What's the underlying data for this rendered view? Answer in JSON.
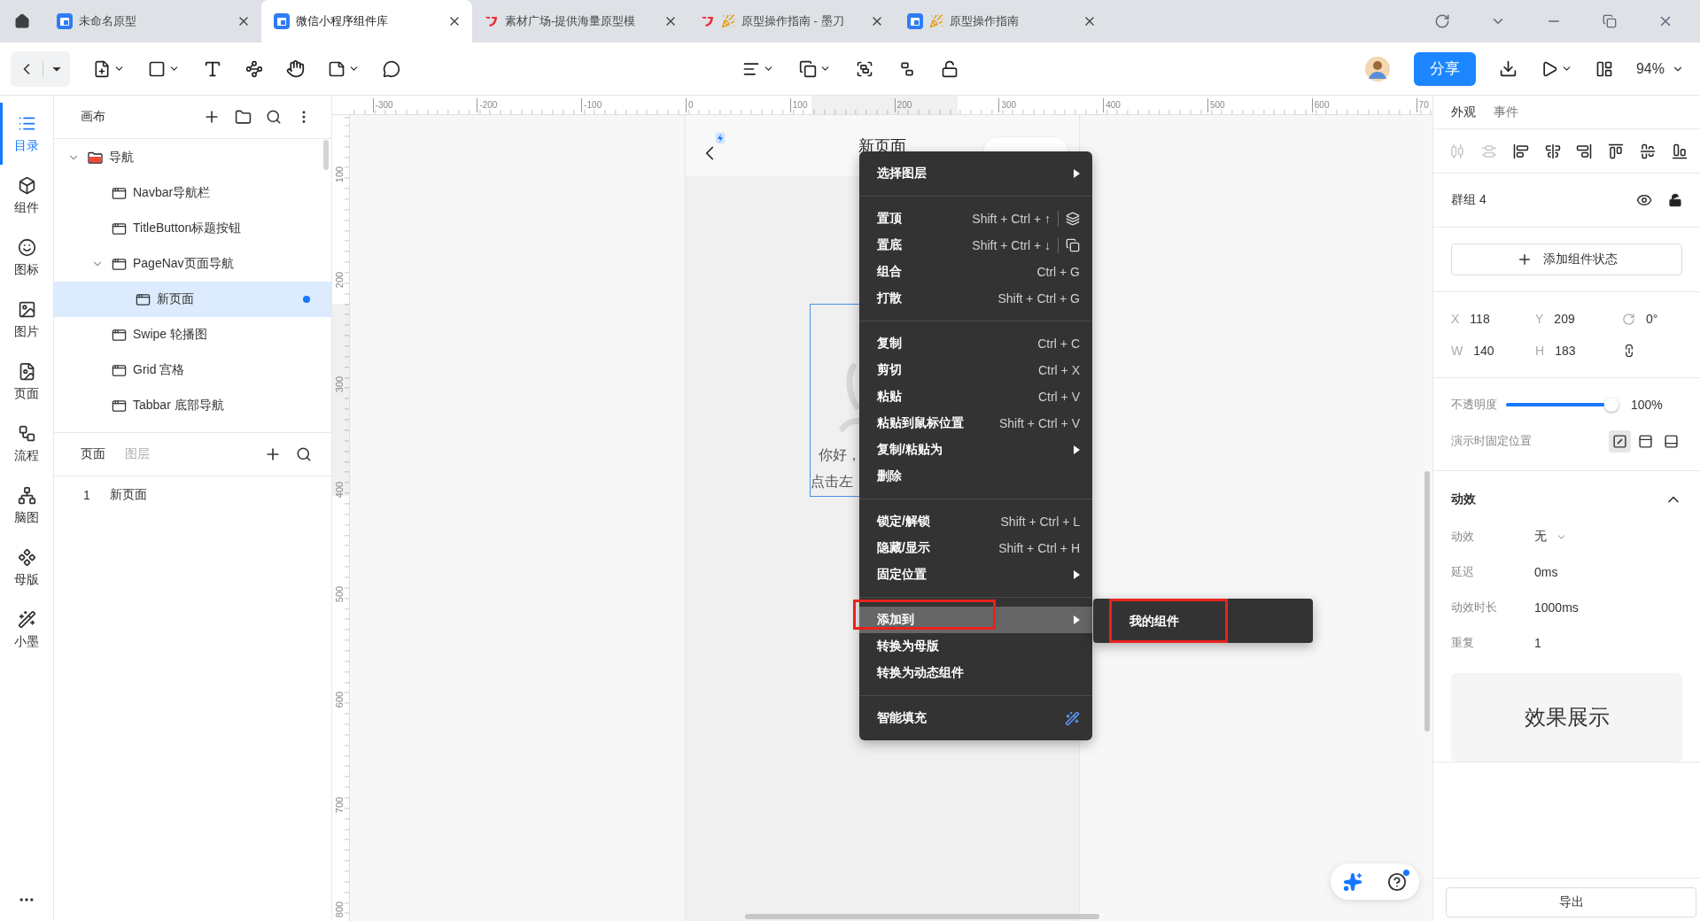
{
  "browser_tabs": [
    {
      "title": "未命名原型",
      "kind": "doc",
      "selected": false
    },
    {
      "title": "微信小程序组件库",
      "kind": "doc",
      "selected": true
    },
    {
      "title": "素材广场-提供海量原型模",
      "kind": "web",
      "selected": false
    },
    {
      "title": "原型操作指南 - 墨刀",
      "kind": "web-guide",
      "selected": false
    },
    {
      "title": "原型操作指南",
      "kind": "doc-guide",
      "selected": false
    }
  ],
  "toolbar": {
    "share": "分享",
    "zoom": "94%"
  },
  "rail": [
    {
      "label": "目录",
      "selected": true
    },
    {
      "label": "组件",
      "selected": false
    },
    {
      "label": "图标",
      "selected": false
    },
    {
      "label": "图片",
      "selected": false
    },
    {
      "label": "页面",
      "selected": false
    },
    {
      "label": "流程",
      "selected": false
    },
    {
      "label": "脑图",
      "selected": false
    },
    {
      "label": "母版",
      "selected": false
    },
    {
      "label": "小墨",
      "selected": false
    }
  ],
  "canvas_panel": {
    "title": "画布",
    "tree": [
      {
        "label": "导航",
        "kind": "folder",
        "expanded": true,
        "selected": false,
        "marked": false,
        "children": [
          {
            "label": "Navbar导航栏",
            "kind": "page",
            "selected": false,
            "marked": false
          },
          {
            "label": "TitleButton标题按钮",
            "kind": "page",
            "selected": false,
            "marked": false
          },
          {
            "label": "PageNav页面导航",
            "kind": "page",
            "expanded": true,
            "selected": false,
            "marked": false,
            "children": [
              {
                "label": "新页面",
                "kind": "page",
                "selected": true,
                "marked": true
              }
            ]
          },
          {
            "label": "Swipe 轮播图",
            "kind": "page",
            "selected": false,
            "marked": false
          },
          {
            "label": "Grid 宫格",
            "kind": "page",
            "selected": false,
            "marked": false
          },
          {
            "label": "Tabbar 底部导航",
            "kind": "page",
            "selected": false,
            "marked": false
          }
        ]
      }
    ]
  },
  "pages_panel": {
    "tabs": [
      {
        "label": "页面",
        "selected": true
      },
      {
        "label": "图层",
        "selected": false
      }
    ],
    "pages": [
      {
        "number": "1",
        "title": "新页面"
      }
    ]
  },
  "ruler": {
    "x_labels": [
      "-300",
      "-200",
      "-100",
      "0",
      "100",
      "200",
      "300",
      "400",
      "500",
      "600",
      "70"
    ],
    "y_labels": [
      "100",
      "200",
      "300",
      "400",
      "500",
      "600",
      "700",
      "800"
    ]
  },
  "page": {
    "title": "新页面",
    "greeting": "你好，",
    "hint": "点击左"
  },
  "context_menu": {
    "sections": [
      [
        {
          "label": "选择图层",
          "kind": "submenu",
          "highlighted": false,
          "annotated": false
        }
      ],
      [
        {
          "label": "置顶",
          "kind": "bring-front",
          "shortcut": "Shift + Ctrl + ↑",
          "highlighted": false,
          "annotated": false
        },
        {
          "label": "置底",
          "kind": "send-back",
          "shortcut": "Shift + Ctrl + ↓",
          "highlighted": false,
          "annotated": false
        },
        {
          "label": "组合",
          "kind": "command",
          "shortcut": "Ctrl + G",
          "highlighted": false,
          "annotated": false
        },
        {
          "label": "打散",
          "kind": "command",
          "shortcut": "Shift + Ctrl + G",
          "highlighted": false,
          "annotated": false
        }
      ],
      [
        {
          "label": "复制",
          "kind": "command",
          "shortcut": "Ctrl + C",
          "highlighted": false,
          "annotated": false
        },
        {
          "label": "剪切",
          "kind": "command",
          "shortcut": "Ctrl + X",
          "highlighted": false,
          "annotated": false
        },
        {
          "label": "粘贴",
          "kind": "command",
          "shortcut": "Ctrl + V",
          "highlighted": false,
          "annotated": false
        },
        {
          "label": "粘贴到鼠标位置",
          "kind": "command",
          "shortcut": "Shift + Ctrl + V",
          "highlighted": false,
          "annotated": false
        },
        {
          "label": "复制/粘贴为",
          "kind": "submenu",
          "highlighted": false,
          "annotated": false
        },
        {
          "label": "删除",
          "kind": "command",
          "highlighted": false,
          "annotated": false
        }
      ],
      [
        {
          "label": "锁定/解锁",
          "kind": "command",
          "shortcut": "Shift + Ctrl + L",
          "highlighted": false,
          "annotated": false
        },
        {
          "label": "隐藏/显示",
          "kind": "command",
          "shortcut": "Shift + Ctrl + H",
          "highlighted": false,
          "annotated": false
        },
        {
          "label": "固定位置",
          "kind": "submenu",
          "highlighted": false,
          "annotated": false
        }
      ],
      [
        {
          "label": "添加到",
          "kind": "submenu",
          "highlighted": true,
          "annotated": true
        },
        {
          "label": "转换为母版",
          "kind": "command",
          "highlighted": false,
          "annotated": false
        },
        {
          "label": "转换为动态组件",
          "kind": "command",
          "highlighted": false,
          "annotated": false
        }
      ],
      [
        {
          "label": "智能填充",
          "kind": "ai",
          "highlighted": false,
          "annotated": false
        }
      ]
    ]
  },
  "submenu": {
    "items": [
      {
        "label": "我的组件",
        "annotated": true
      }
    ]
  },
  "properties": {
    "tabs": [
      {
        "label": "外观",
        "selected": true
      },
      {
        "label": "事件",
        "selected": false
      }
    ],
    "align_tools": [
      {
        "disabled": true
      },
      {
        "disabled": true
      },
      {
        "disabled": false
      },
      {
        "disabled": false
      },
      {
        "disabled": false
      },
      {
        "disabled": false
      },
      {
        "disabled": false
      },
      {
        "disabled": false
      }
    ],
    "layer_name": "群组 4",
    "add_state": "添加组件状态",
    "geometry": [
      {
        "kind": "field",
        "label": "X",
        "value": "118"
      },
      {
        "kind": "field",
        "label": "Y",
        "value": "209"
      },
      {
        "kind": "rotation",
        "value": "0°"
      },
      {
        "kind": "field",
        "label": "W",
        "value": "140"
      },
      {
        "kind": "field",
        "label": "H",
        "value": "183"
      },
      {
        "kind": "ratio-lock"
      }
    ],
    "opacity": {
      "label": "不透明度",
      "level": 1,
      "reading": "100%"
    },
    "pin": {
      "label": "演示时固定位置",
      "options": [
        {
          "selected": true
        },
        {
          "selected": false
        },
        {
          "selected": false
        }
      ]
    },
    "animation": {
      "title": "动效",
      "expanded": true,
      "rows": [
        {
          "label": "动效",
          "value": "无",
          "kind": "select"
        },
        {
          "label": "延迟",
          "value": "0ms",
          "kind": "text"
        },
        {
          "label": "动效时长",
          "value": "1000ms",
          "kind": "text"
        },
        {
          "label": "重复",
          "value": "1",
          "kind": "text"
        }
      ],
      "preview": "效果展示"
    },
    "export": "导出"
  }
}
